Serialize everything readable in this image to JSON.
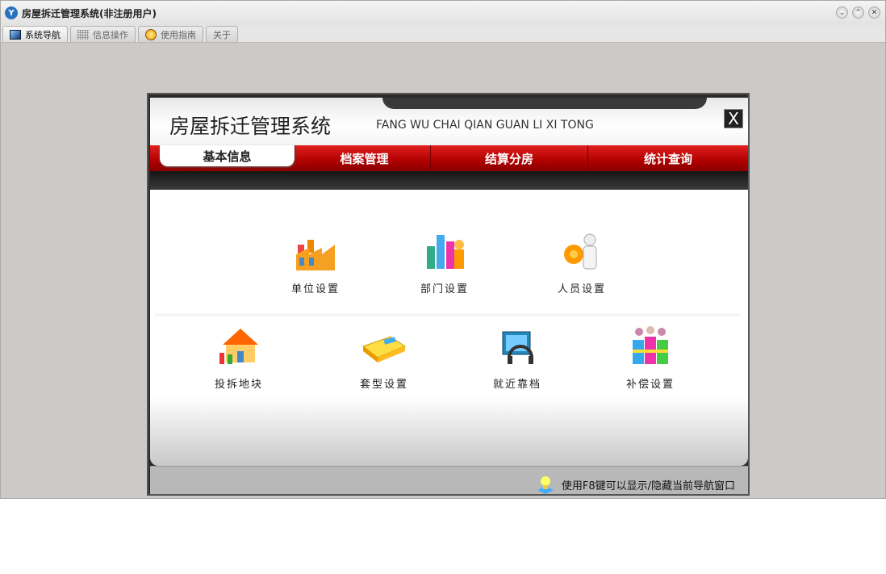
{
  "window": {
    "title": "房屋拆迁管理系统(非注册用户)",
    "logo": "Y"
  },
  "window_buttons": [
    "⌄",
    "⌃",
    "✕"
  ],
  "tabs": [
    {
      "label": "系统导航",
      "icon": "monitor-icon"
    },
    {
      "label": "信息操作",
      "icon": "grid-icon"
    },
    {
      "label": "使用指南",
      "icon": "help-icon"
    },
    {
      "label": "关于"
    }
  ],
  "header": {
    "title": "房屋拆迁管理系统",
    "subtitle": "FANG WU CHAI QIAN GUAN LI XI TONG",
    "close": "X"
  },
  "nav": [
    "基本信息",
    "档案管理",
    "结算分房",
    "统计查询"
  ],
  "items": [
    {
      "label": "单位设置",
      "icon": "factory-icon"
    },
    {
      "label": "部门设置",
      "icon": "department-icon"
    },
    {
      "label": "人员设置",
      "icon": "people-icon"
    },
    {
      "label": "投拆地块",
      "icon": "house-icon"
    },
    {
      "label": "套型设置",
      "icon": "book-icon"
    },
    {
      "label": "就近靠档",
      "icon": "headset-icon"
    },
    {
      "label": "补偿设置",
      "icon": "gift-icon"
    }
  ],
  "footer": {
    "tip": "使用F8键可以显示/隐藏当前导航窗口"
  },
  "colors": {
    "nav_red": "#c00000",
    "bg": "#cdc9c6"
  }
}
